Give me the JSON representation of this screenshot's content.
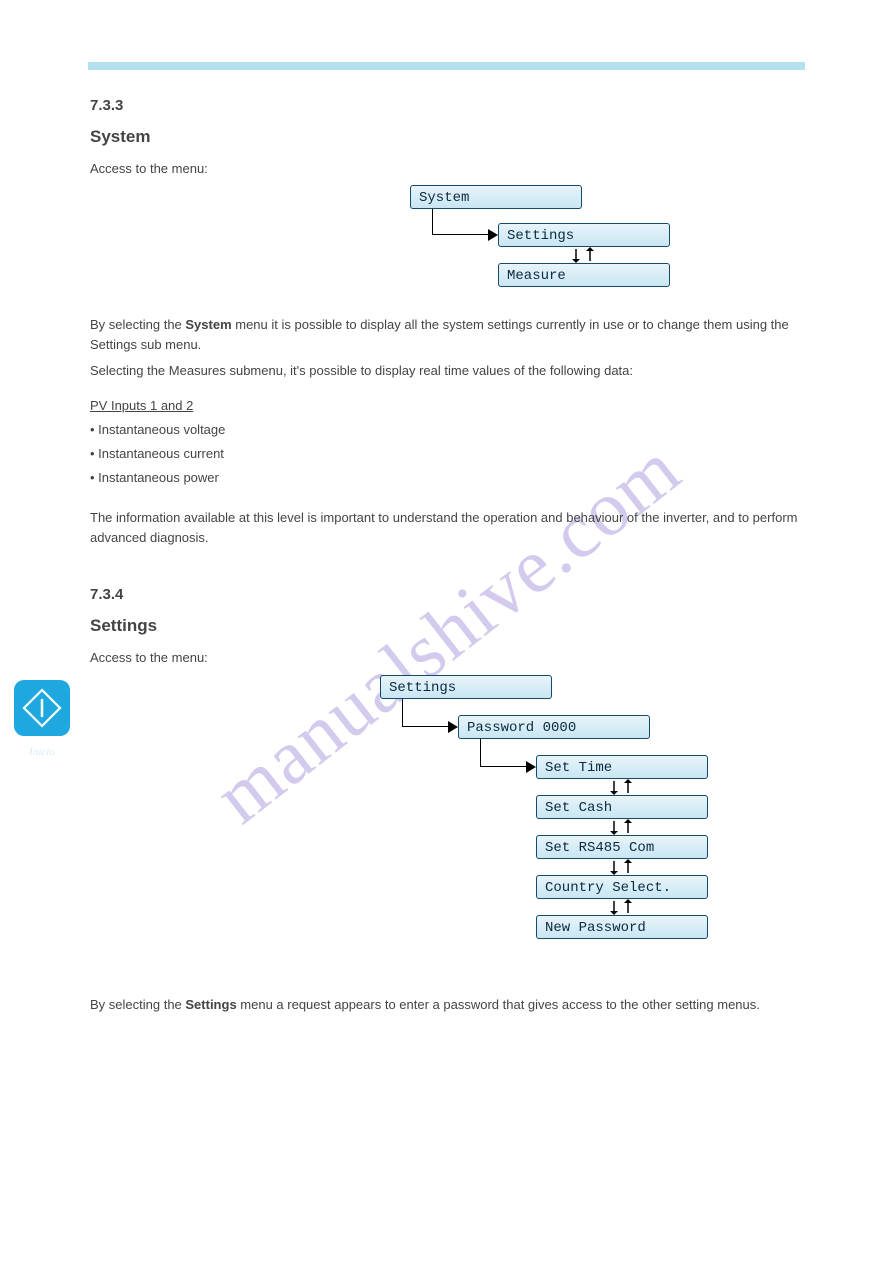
{
  "section3": {
    "num": "7.3.3",
    "title": "System",
    "access_label": "Access to the menu:",
    "para1_prefix": "By selecting the ",
    "para1_strong": "System",
    "para1_rest": " menu it is possible to display all the system settings currently in use or to change them using the Settings sub menu.",
    "measure_prefix": "Selecting the Measures submenu, it's possible to display real time values of the following data:",
    "table_head": "PV Inputs 1 and 2",
    "bullet1": "• Instantaneous voltage",
    "bullet2": "• Instantaneous current",
    "bullet3": "• Instantaneous power",
    "foot_para": "The information available at this level is important to understand the operation and behaviour of the inverter, and to perform advanced diagnosis."
  },
  "section4": {
    "num": "7.3.4",
    "title": "Settings",
    "access_label": "Access to the menu:",
    "para1_prefix": "By selecting the ",
    "para1_strong": "Settings",
    "para1_rest": " menu a request appears to enter a password that gives access to the other setting menus."
  },
  "menus": {
    "system": "System",
    "settings": "Settings",
    "measure": "Measure",
    "password": "Password 0000",
    "set_time": "Set Time",
    "set_cash": "Set Cash",
    "set_rs485": "Set RS485 Com",
    "country": "Country Select.",
    "new_password": "New Password"
  },
  "sidebar": {
    "caption": "Inicio"
  }
}
